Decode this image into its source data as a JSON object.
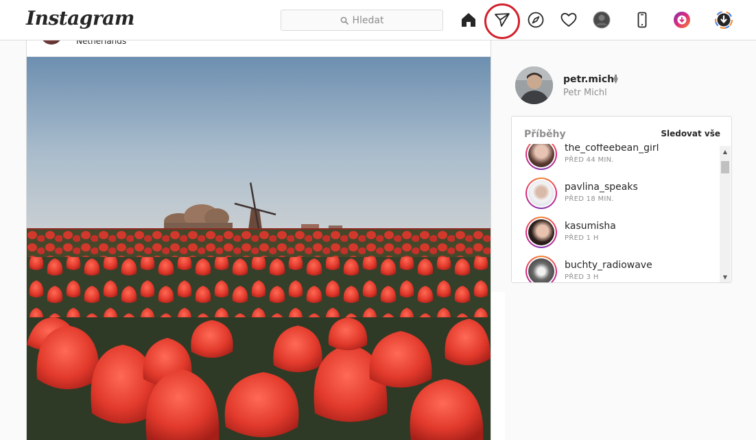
{
  "header": {
    "logo": "Instagram",
    "search_placeholder": "Hledat",
    "icons": [
      "home-icon",
      "direct-messages-icon",
      "explore-icon",
      "activity-heart-icon",
      "profile-avatar-icon",
      "mobile-app-icon",
      "extension-icon",
      "download-icon"
    ],
    "highlight_color": "#d21f2b"
  },
  "post": {
    "location": "Netherlands"
  },
  "profile": {
    "username": "petr.michl",
    "full_name": "Petr Michl"
  },
  "stories": {
    "title": "Příběhy",
    "watch_all": "Sledovat vše",
    "items": [
      {
        "username": "the_coffeebean_girl",
        "time": "PŘED 44 MIN."
      },
      {
        "username": "pavlina_speaks",
        "time": "PŘED 18 MIN."
      },
      {
        "username": "kasumisha",
        "time": "PŘED 1 H"
      },
      {
        "username": "buchty_radiowave",
        "time": "PŘED 3 H"
      }
    ]
  }
}
